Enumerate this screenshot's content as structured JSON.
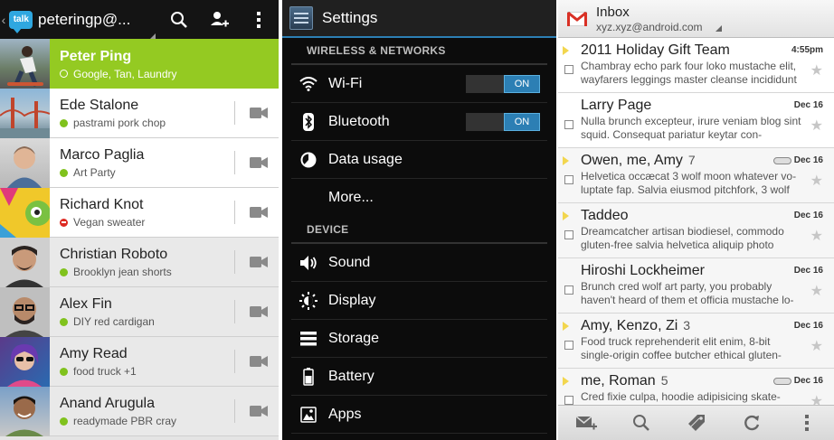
{
  "talk": {
    "logo_text": "talk",
    "account": "peteringp@...",
    "contacts": [
      {
        "name": "Peter Ping",
        "status": "Google, Tan, Laundry",
        "presence": "ring"
      },
      {
        "name": "Ede Stalone",
        "status": "pastrami pork chop",
        "presence": "available"
      },
      {
        "name": "Marco Paglia",
        "status": "Art Party",
        "presence": "available"
      },
      {
        "name": "Richard Knot",
        "status": "Vegan sweater",
        "presence": "busy"
      },
      {
        "name": "Christian Roboto",
        "status": "Brooklyn jean shorts",
        "presence": "available"
      },
      {
        "name": "Alex Fin",
        "status": "DIY red cardigan",
        "presence": "available"
      },
      {
        "name": "Amy Read",
        "status": "food truck +1",
        "presence": "available"
      },
      {
        "name": "Anand Arugula",
        "status": "readymade PBR cray",
        "presence": "available"
      }
    ]
  },
  "settings": {
    "title": "Settings",
    "section_wireless": "WIRELESS & NETWORKS",
    "wifi": "Wi-Fi",
    "wifi_state": "ON",
    "bluetooth": "Bluetooth",
    "bluetooth_state": "ON",
    "data_usage": "Data usage",
    "more": "More...",
    "section_device": "DEVICE",
    "sound": "Sound",
    "display": "Display",
    "storage": "Storage",
    "battery": "Battery",
    "apps": "Apps"
  },
  "gmail": {
    "title": "Inbox",
    "account": "xyz.xyz@android.com",
    "messages": [
      {
        "sender": "2011 Holiday Gift Team",
        "count": "",
        "date": "4:55pm",
        "snippet": "Chambray echo park four loko mustache elit, wayfarers leggings master cleanse incididunt",
        "important": true,
        "label": false
      },
      {
        "sender": "Larry Page",
        "count": "",
        "date": "Dec 16",
        "snippet": "Nulla brunch excepteur, irure veniam blog sint squid. Consequat pariatur keytar con-",
        "important": false,
        "label": false
      },
      {
        "sender": "Owen, me, Amy",
        "count": "7",
        "date": "Dec 16",
        "snippet": "Helvetica occæcat 3 wolf moon whatever vo-luptate fap. Salvia eiusmod pitchfork, 3 wolf",
        "important": true,
        "label": true
      },
      {
        "sender": "Taddeo",
        "count": "",
        "date": "Dec 16",
        "snippet": "Dreamcatcher artisan biodiesel, commodo gluten-free salvia helvetica aliquip photo",
        "important": true,
        "label": false
      },
      {
        "sender": "Hiroshi Lockheimer",
        "count": "",
        "date": "Dec 16",
        "snippet": "Brunch cred wolf art party, you probably haven't heard of them et officia mustache lo-",
        "important": false,
        "label": false
      },
      {
        "sender": "Amy, Kenzo, Zi",
        "count": "3",
        "date": "Dec 16",
        "snippet": "Food truck reprehenderit elit enim, 8-bit single-origin coffee butcher ethical gluten-",
        "important": true,
        "label": false
      },
      {
        "sender": "me, Roman",
        "count": "5",
        "date": "Dec 16",
        "snippet": "Cred fixie culpa, hoodie adipisicing skate-",
        "important": true,
        "label": true
      }
    ]
  },
  "colors": {
    "talk_active": "#94ca22",
    "talk_presence_available": "#80c21d",
    "talk_presence_busy": "#dd2a22",
    "settings_accent": "#2c7fb4",
    "gmail_important": "#f2d64e"
  },
  "icons": {
    "talk_bar": [
      "search-icon",
      "add-contact-icon",
      "overflow-menu-icon"
    ],
    "talk_row": "video-camera-icon",
    "settings": [
      "wifi-icon",
      "bluetooth-icon",
      "data-usage-icon",
      "sound-icon",
      "display-icon",
      "storage-icon",
      "battery-icon",
      "apps-icon"
    ],
    "gmail_bottom": [
      "compose-icon",
      "search-icon",
      "labels-icon",
      "refresh-icon",
      "overflow-menu-icon"
    ]
  }
}
